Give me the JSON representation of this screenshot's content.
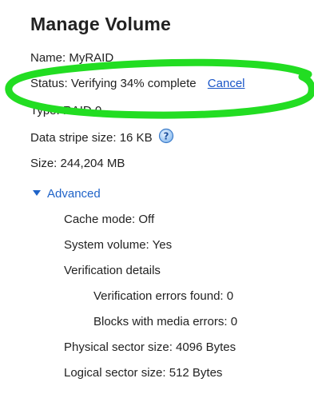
{
  "panel": {
    "title": "Manage Volume",
    "name_row": "Name: MyRAID",
    "status_row": "Status: Verifying 34% complete",
    "cancel_label": "Cancel",
    "type_row": "Type: RAID 0",
    "stripe_row": "Data stripe size: 16 KB",
    "size_row": "Size: 244,204 MB",
    "help_icon": "help-question-icon"
  },
  "advanced": {
    "label": "Advanced",
    "icon": "triangle-down-icon",
    "cache_mode": "Cache mode: Off",
    "system_volume": "System volume: Yes",
    "verification_details": "Verification details",
    "verification_errors": "Verification errors found: 0",
    "media_errors": "Blocks with media errors: 0",
    "physical_sector": "Physical sector size: 4096 Bytes",
    "logical_sector": "Logical sector size: 512 Bytes"
  },
  "colors": {
    "link": "#1a56c8",
    "highlight": "#22dd22",
    "text": "#222222"
  }
}
